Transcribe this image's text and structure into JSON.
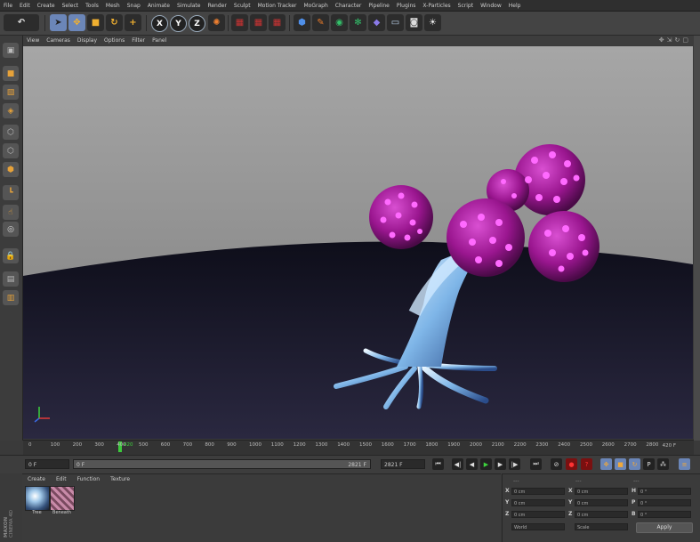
{
  "menu": [
    "File",
    "Edit",
    "Create",
    "Select",
    "Tools",
    "Mesh",
    "Snap",
    "Animate",
    "Simulate",
    "Render",
    "Sculpt",
    "Motion Tracker",
    "MoGraph",
    "Character",
    "Pipeline",
    "Plugins",
    "X-Particles",
    "Script",
    "Window",
    "Help"
  ],
  "toolbar": {
    "axis_x": "X",
    "axis_y": "Y",
    "axis_z": "Z"
  },
  "viewport_menu": [
    "View",
    "Cameras",
    "Display",
    "Options",
    "Filter",
    "Panel"
  ],
  "timeline": {
    "ticks": [
      "0",
      "100",
      "200",
      "300",
      "400",
      "500",
      "600",
      "700",
      "800",
      "900",
      "1000",
      "1100",
      "1200",
      "1300",
      "1400",
      "1500",
      "1600",
      "1700",
      "1800",
      "1900",
      "2000",
      "2100",
      "2200",
      "2300",
      "2400",
      "2500",
      "2600",
      "2700",
      "2800"
    ],
    "frame_label": "420 F",
    "playhead_label": "420"
  },
  "playback": {
    "start_field": "0 F",
    "range_field": "0 F",
    "range_end": "2821 F",
    "end_field": "2821 F"
  },
  "material_manager": {
    "menu": [
      "Create",
      "Edit",
      "Function",
      "Texture"
    ],
    "materials": [
      {
        "name": "Tree"
      },
      {
        "name": "Beneath"
      }
    ]
  },
  "logo_text": [
    "MAXON",
    "CINEMA 4D"
  ],
  "attributes": {
    "rows": [
      {
        "axis": "X",
        "pos": "0 cm",
        "size": "0 cm",
        "rot_label": "H",
        "rot": "0 °"
      },
      {
        "axis": "Y",
        "pos": "0 cm",
        "size": "0 cm",
        "rot_label": "P",
        "rot": "0 °"
      },
      {
        "axis": "Z",
        "pos": "0 cm",
        "size": "0 cm",
        "rot_label": "B",
        "rot": "0 °"
      }
    ],
    "mode_left": "World",
    "mode_mid": "Scale",
    "apply_label": "Apply"
  },
  "colors": {
    "sphere_magenta": "#b01aa8",
    "dot_pink": "#ff6aff",
    "floor": "#1c1b2c",
    "bg_gray": "#9a9a9a",
    "trunk_glow": "#cfe8ff"
  }
}
